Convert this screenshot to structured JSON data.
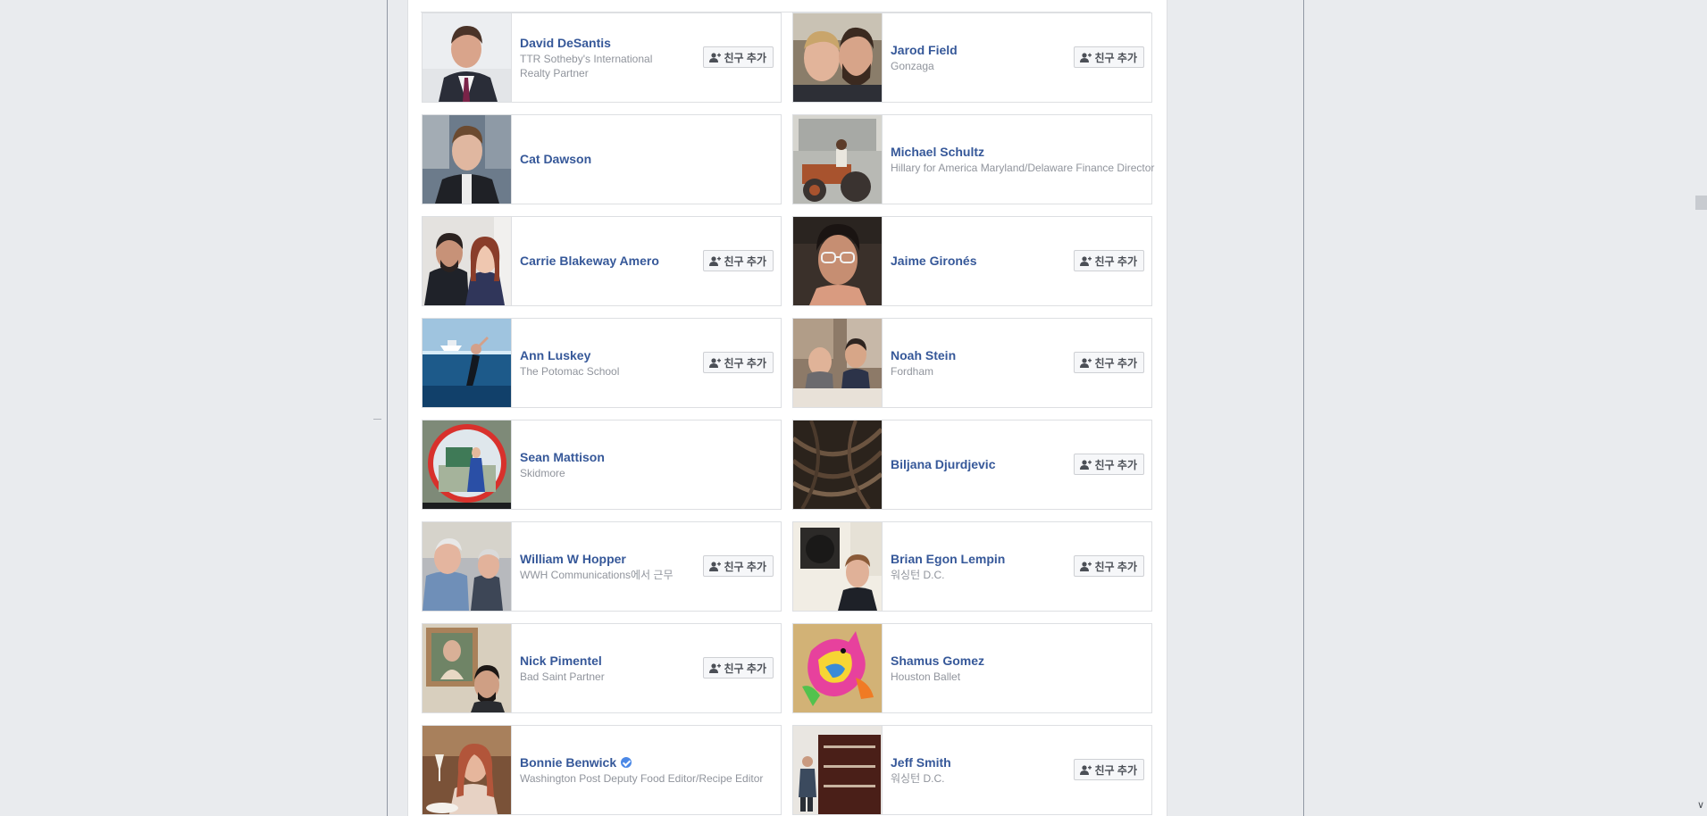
{
  "add_button_label": "친구 추가",
  "friends": [
    {
      "name": "David DeSantis",
      "sub": "TTR Sotheby's International Realty Partner",
      "has_add_button": true,
      "photo": "man-suit-portrait"
    },
    {
      "name": "Jarod Field",
      "sub": "Gonzaga",
      "has_add_button": true,
      "photo": "two-men-selfie"
    },
    {
      "name": "Cat Dawson",
      "sub": "",
      "has_add_button": false,
      "photo": "man-city-selfie"
    },
    {
      "name": "Michael Schultz",
      "sub": "Hillary for America Maryland/Delaware Finance Director",
      "has_add_button": false,
      "photo": "man-on-tractor"
    },
    {
      "name": "Carrie Blakeway Amero",
      "sub": "",
      "has_add_button": true,
      "photo": "couple-portrait"
    },
    {
      "name": "Jaime Gironés",
      "sub": "",
      "has_add_button": true,
      "photo": "man-glasses-selfie"
    },
    {
      "name": "Ann Luskey",
      "sub": "The Potomac School",
      "has_add_button": true,
      "photo": "swimmer-underwater"
    },
    {
      "name": "Noah Stein",
      "sub": "Fordham",
      "has_add_button": true,
      "photo": "two-people-couch"
    },
    {
      "name": "Sean Mattison",
      "sub": "Skidmore",
      "has_add_button": false,
      "photo": "mirror-reflection"
    },
    {
      "name": "Biljana Djurdjevic",
      "sub": "",
      "has_add_button": true,
      "photo": "dark-sculpture"
    },
    {
      "name": "William W Hopper",
      "sub": "WWH Communications에서 근무",
      "has_add_button": true,
      "photo": "two-older-men"
    },
    {
      "name": "Brian Egon Lempin",
      "sub": "워싱턴 D.C.",
      "has_add_button": true,
      "photo": "man-before-painting"
    },
    {
      "name": "Nick Pimentel",
      "sub": "Bad Saint Partner",
      "has_add_button": true,
      "photo": "man-with-painting"
    },
    {
      "name": "Shamus Gomez",
      "sub": "Houston Ballet",
      "has_add_button": false,
      "photo": "colorful-pinata"
    },
    {
      "name": "Bonnie Benwick",
      "sub": "Washington Post Deputy Food Editor/Recipe Editor",
      "has_add_button": false,
      "verified": true,
      "photo": "woman-dining-toast"
    },
    {
      "name": "Jeff Smith",
      "sub": "워싱턴 D.C.",
      "has_add_button": true,
      "photo": "man-in-store"
    }
  ]
}
